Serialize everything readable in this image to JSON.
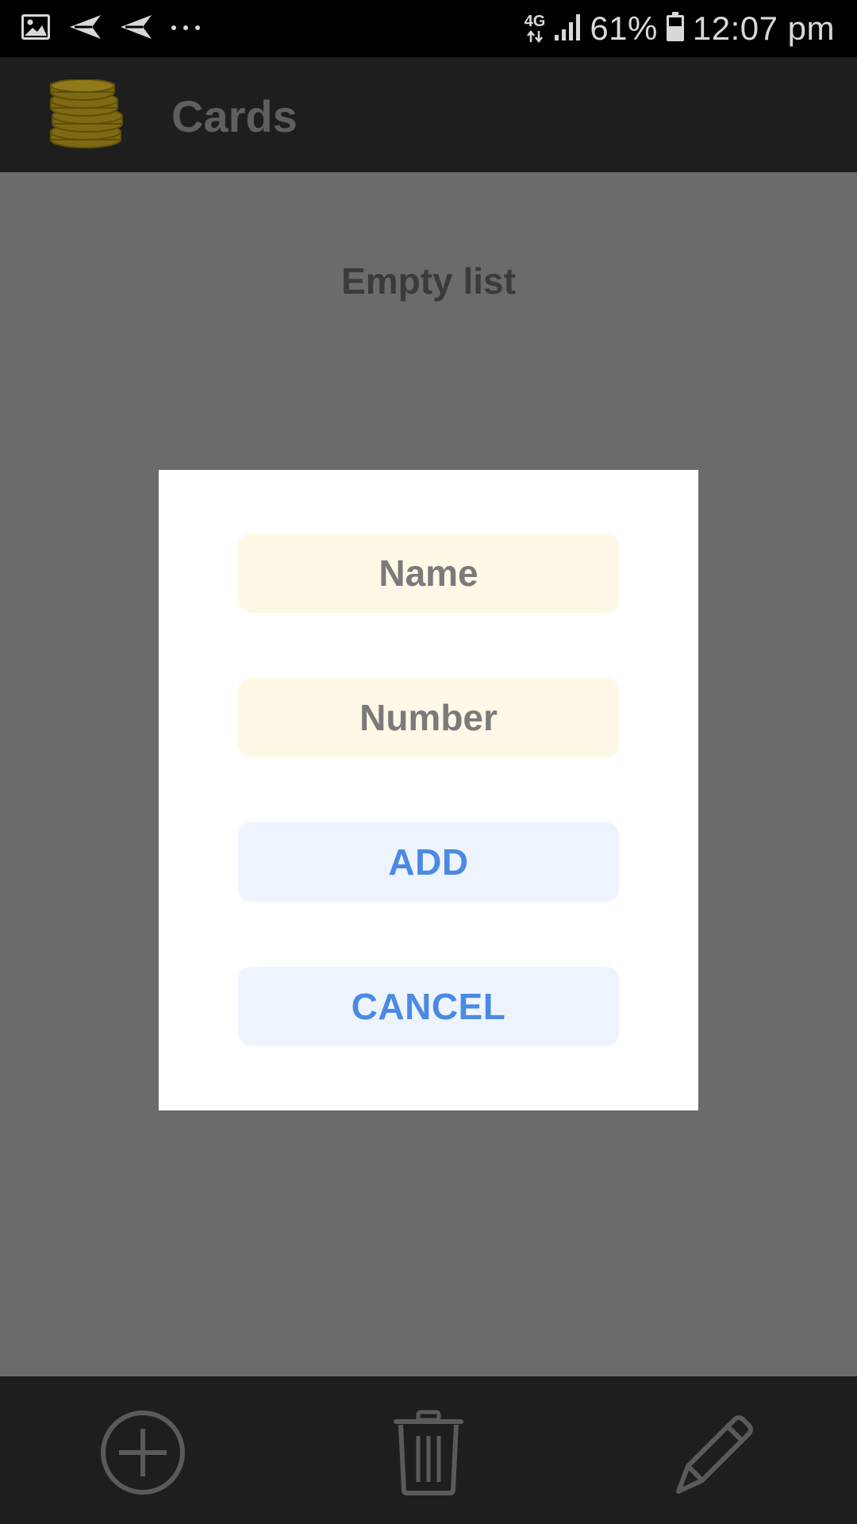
{
  "status_bar": {
    "network_type": "4G",
    "battery_percent": "61%",
    "time": "12:07 pm",
    "icons": [
      "image-icon",
      "send-icon",
      "send-icon",
      "more-dots-icon",
      "data-arrows-icon",
      "signal-icon",
      "battery-icon"
    ]
  },
  "app_bar": {
    "title": "Cards",
    "logo": "coin-stack-icon"
  },
  "content": {
    "empty_message": "Empty list"
  },
  "dialog": {
    "name_placeholder": "Name",
    "number_placeholder": "Number",
    "add_label": "ADD",
    "cancel_label": "CANCEL"
  },
  "bottom_bar": {
    "icons": [
      "add-circle-icon",
      "trash-icon",
      "pencil-icon"
    ]
  },
  "colors": {
    "field_bg": "#fff8e6",
    "button_bg": "#eef4fd",
    "button_text": "#4b89e3",
    "coin": "#8a7413"
  }
}
